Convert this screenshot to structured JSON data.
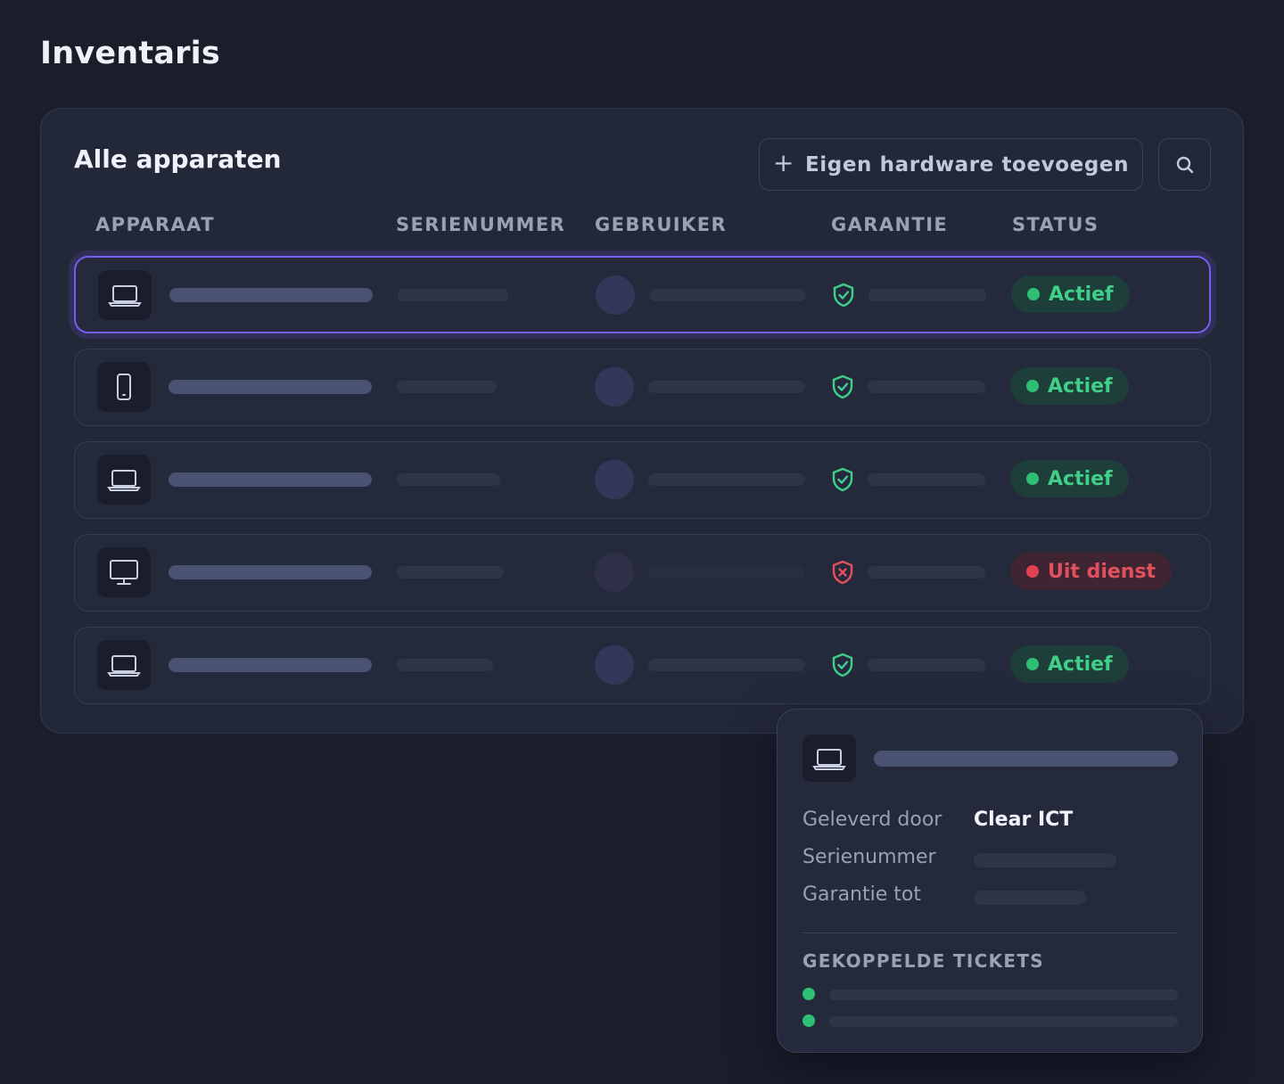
{
  "page": {
    "title": "Inventaris"
  },
  "card": {
    "title": "Alle apparaten",
    "add_button": {
      "icon": "plus-icon",
      "label": "Eigen hardware toevoegen"
    },
    "search_button": {
      "icon": "search-icon"
    }
  },
  "table": {
    "columns": [
      "APPARAAT",
      "SERIENUMMER",
      "GEBRUIKER",
      "GARANTIE",
      "STATUS"
    ],
    "rows": [
      {
        "device_icon": "laptop-icon",
        "warranty_icon": "shield-check-icon",
        "status": "Actief",
        "status_kind": "active",
        "selected": true
      },
      {
        "device_icon": "smartphone-icon",
        "warranty_icon": "shield-check-icon",
        "status": "Actief",
        "status_kind": "active",
        "selected": false
      },
      {
        "device_icon": "laptop-icon",
        "warranty_icon": "shield-check-icon",
        "status": "Actief",
        "status_kind": "active",
        "selected": false
      },
      {
        "device_icon": "monitor-icon",
        "warranty_icon": "shield-x-icon",
        "status": "Uit dienst",
        "status_kind": "inactive",
        "selected": false
      },
      {
        "device_icon": "laptop-icon",
        "warranty_icon": "shield-check-icon",
        "status": "Actief",
        "status_kind": "active",
        "selected": false
      }
    ]
  },
  "popover": {
    "device_icon": "laptop-icon",
    "fields": [
      {
        "label": "Geleverd door",
        "value": "Clear ICT"
      },
      {
        "label": "Serienummer",
        "value": ""
      },
      {
        "label": "Garantie tot",
        "value": ""
      }
    ],
    "section_title": "GEKOPPELDE TICKETS"
  },
  "colors": {
    "background": "#1a1e2b",
    "card": "#232839",
    "accent_selected": "#7a5cf0",
    "status_active": "#3fcf88",
    "status_inactive": "#e2505e"
  }
}
